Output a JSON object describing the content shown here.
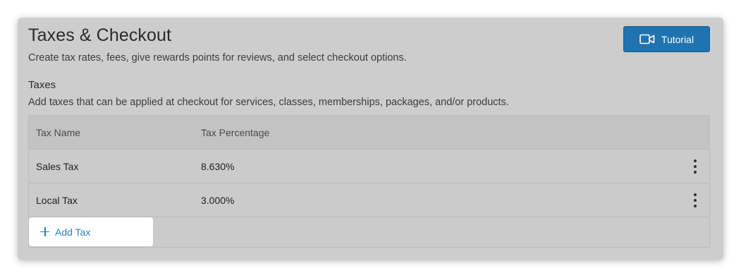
{
  "header": {
    "title": "Taxes & Checkout",
    "subtitle": "Create tax rates, fees, give rewards points for reviews, and select checkout options.",
    "tutorial_label": "Tutorial",
    "tutorial_icon": "video-camera-icon"
  },
  "taxes": {
    "section_title": "Taxes",
    "section_description": "Add taxes that can be applied at checkout for services, classes, memberships, packages, and/or products.",
    "columns": [
      "Tax Name",
      "Tax Percentage"
    ],
    "rows": [
      {
        "name": "Sales Tax",
        "percentage": "8.630%"
      },
      {
        "name": "Local Tax",
        "percentage": "3.000%"
      }
    ],
    "add_label": "Add Tax"
  },
  "colors": {
    "accent": "#1f73b0",
    "link": "#2d7fc0",
    "card_background": "#cdcdcd"
  }
}
